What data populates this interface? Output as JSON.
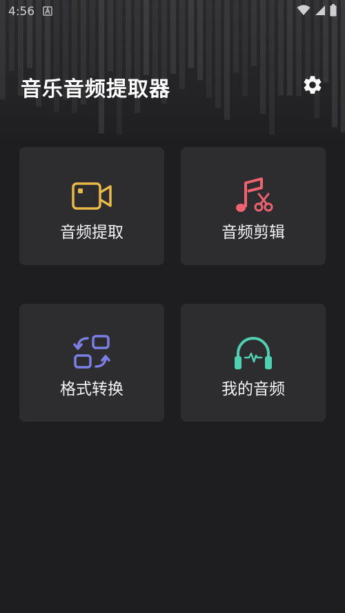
{
  "status_bar": {
    "time": "4:56",
    "icons": [
      "notification-a-icon",
      "wifi-icon",
      "signal-icon",
      "battery-icon"
    ]
  },
  "header": {
    "title": "音乐音频提取器",
    "settings_icon": "gear-icon"
  },
  "cards": [
    {
      "label": "音频提取",
      "icon": "video-camera-icon",
      "color": "#e9b949"
    },
    {
      "label": "音频剪辑",
      "icon": "music-scissors-icon",
      "color": "#ef6270"
    },
    {
      "label": "格式转换",
      "icon": "convert-icon",
      "color": "#7b80e6"
    },
    {
      "label": "我的音频",
      "icon": "headphones-icon",
      "color": "#4fd0b0"
    }
  ],
  "colors": {
    "background": "#1e1e20",
    "card": "#2d2d2f",
    "text": "#ffffff"
  }
}
